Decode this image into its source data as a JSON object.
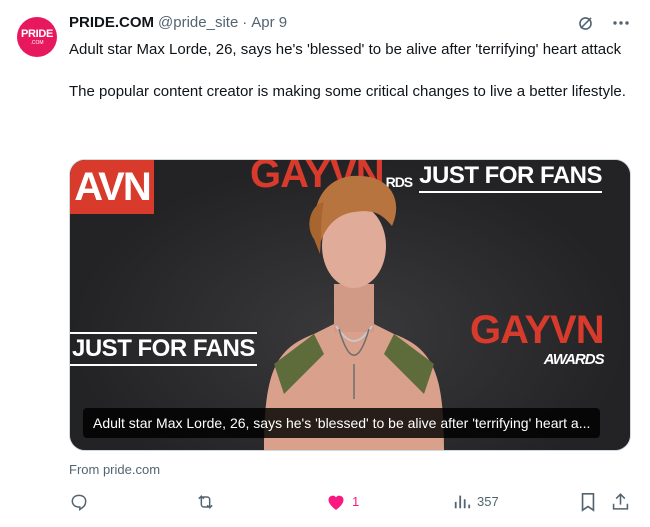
{
  "tweet": {
    "avatar": {
      "line1": "PRIDE",
      "line2": ".COM",
      "color": "#e8185f"
    },
    "display_name": "PRIDE.COM",
    "handle": "@pride_site",
    "separator": "·",
    "date": "Apr 9",
    "headline": "Adult star Max Lorde, 26, says he's 'blessed' to be alive after 'terrifying' heart attack",
    "body": "The popular content creator is making some critical changes to live a better lifestyle.",
    "header_icons": [
      "grok-icon",
      "more-icon"
    ]
  },
  "media": {
    "backdrop_logos": {
      "avn": "AVN",
      "gayvn_top": "GAYVN",
      "gayvn_top_suffix": "RDS",
      "justforfans_top": "JUST FOR FANS",
      "justforfans_left": "JUST FOR FANS",
      "gayvn_right": "GAYVN",
      "gayvn_right_sub": "AWARDS"
    },
    "caption": "Adult star Max Lorde, 26, says he's 'blessed' to be alive after 'terrifying' heart a..."
  },
  "link_source": "From pride.com",
  "actions": {
    "reply": {
      "icon": "reply-icon",
      "count": ""
    },
    "retweet": {
      "icon": "retweet-icon",
      "count": ""
    },
    "like": {
      "icon": "heart-icon",
      "count": "1",
      "color": "#f91880"
    },
    "views": {
      "icon": "views-icon",
      "count": "357"
    },
    "bookmark": {
      "icon": "bookmark-icon"
    },
    "share": {
      "icon": "share-icon"
    }
  }
}
